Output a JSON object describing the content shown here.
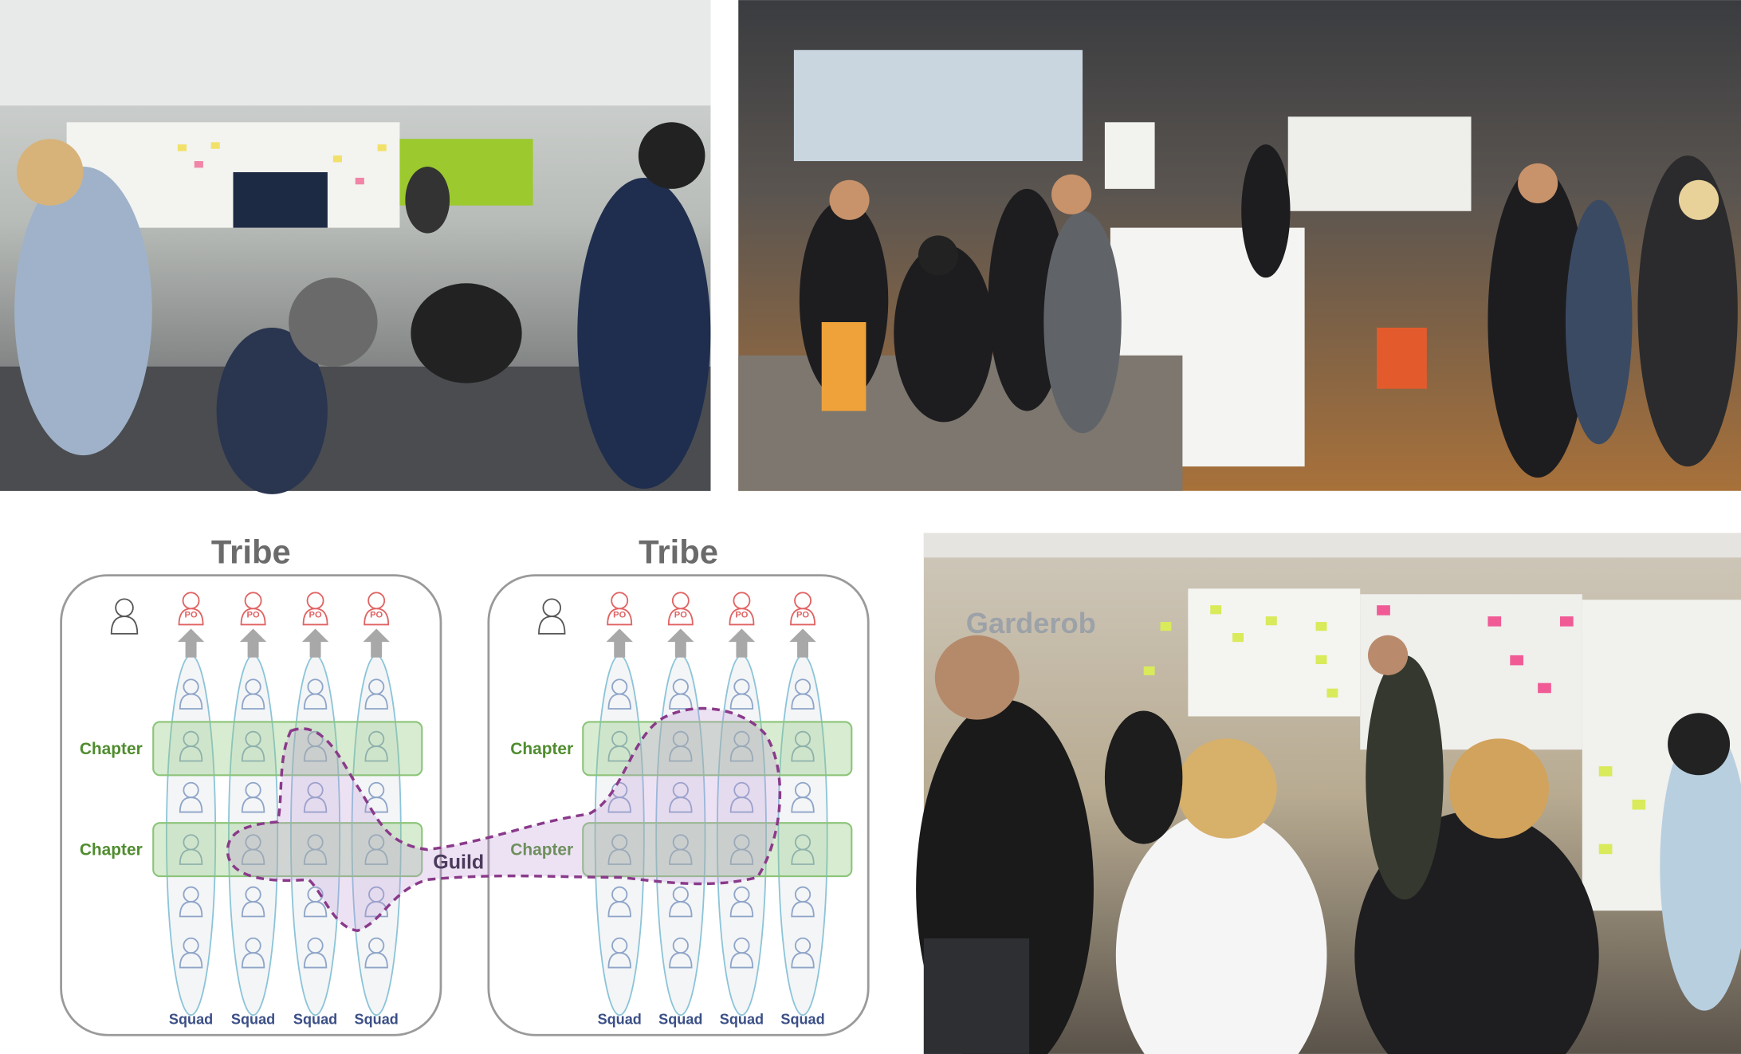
{
  "photos": [
    {
      "name": "office-meeting-photo",
      "subject": "team meeting in office lounge with whiteboard and sticky notes"
    },
    {
      "name": "workshop-crowd-photo",
      "subject": "large group standing at workshop with flip charts"
    },
    {
      "name": "sticky-note-wall-photo",
      "subject": "team standing at wall covered with sticky notes",
      "sign_text": "Garderob"
    }
  ],
  "diagram": {
    "tribes": [
      {
        "title": "Tribe",
        "chapters": [
          "Chapter",
          "Chapter"
        ],
        "squads": [
          "Squad",
          "Squad",
          "Squad",
          "Squad"
        ],
        "po_label": "PO"
      },
      {
        "title": "Tribe",
        "chapters": [
          "Chapter",
          "Chapter"
        ],
        "squads": [
          "Squad",
          "Squad",
          "Squad",
          "Squad"
        ],
        "po_label": "PO"
      }
    ],
    "guild_label": "Guild",
    "colors": {
      "po": "#e06262",
      "squad": "#8cc4d8",
      "chapter": "#8cc47a",
      "guild": "#8a3a8a",
      "tribe_border": "#9a9a9a"
    }
  }
}
